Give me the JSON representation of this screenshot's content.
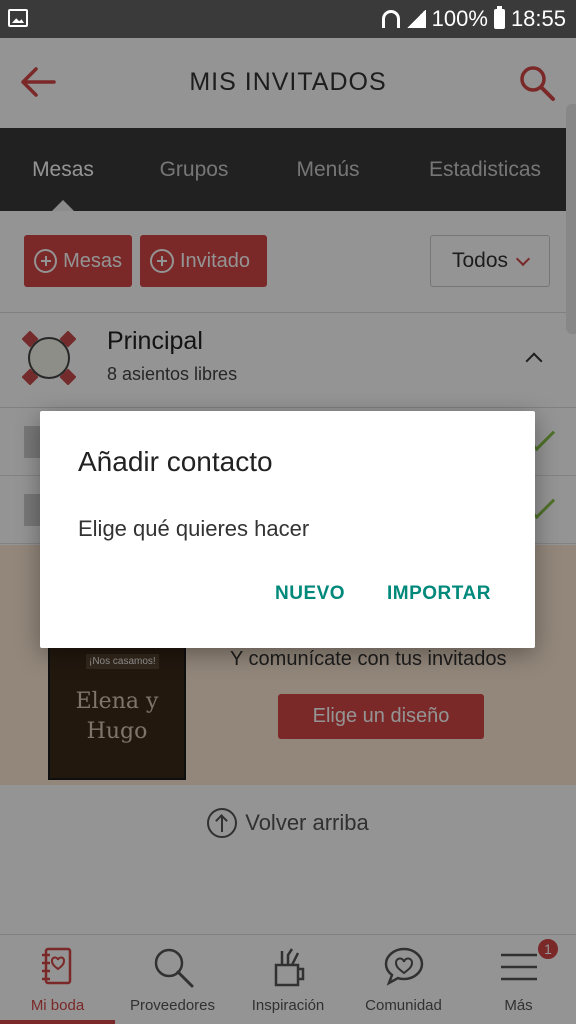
{
  "status_bar": {
    "battery": "100%",
    "time": "18:55"
  },
  "header": {
    "title": "MIS INVITADOS"
  },
  "tabs": [
    {
      "label": "Mesas"
    },
    {
      "label": "Grupos"
    },
    {
      "label": "Menús"
    },
    {
      "label": "Estadisticas"
    }
  ],
  "actions": {
    "add_table": "Mesas",
    "add_guest": "Invitado",
    "filter_value": "Todos"
  },
  "table_card": {
    "name": "Principal",
    "seats": "8 asientos libres"
  },
  "promo": {
    "invite_tagline": "¡Nos casamos!",
    "invite_names": "Elena y\nHugo",
    "text": "Y comunícate con tus invitados",
    "button": "Elige un diseño"
  },
  "back_to_top": "Volver arriba",
  "nav": [
    {
      "label": "Mi boda"
    },
    {
      "label": "Proveedores"
    },
    {
      "label": "Inspiración"
    },
    {
      "label": "Comunidad"
    },
    {
      "label": "Más"
    }
  ],
  "nav_badge": "1",
  "dialog": {
    "title": "Añadir contacto",
    "message": "Elige qué quieres hacer",
    "new_button": "NUEVO",
    "import_button": "IMPORTAR"
  },
  "colors": {
    "accent": "#d44646",
    "dialog_button": "#00897b",
    "tab_bar": "#3a3a3a"
  }
}
